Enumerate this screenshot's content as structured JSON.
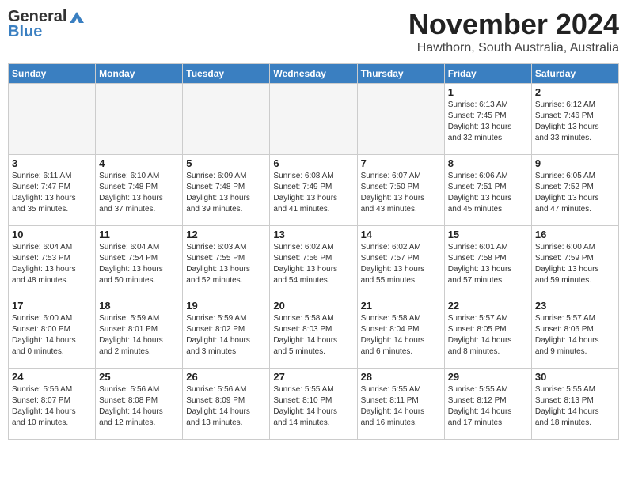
{
  "header": {
    "logo_general": "General",
    "logo_blue": "Blue",
    "month_title": "November 2024",
    "location": "Hawthorn, South Australia, Australia"
  },
  "days_of_week": [
    "Sunday",
    "Monday",
    "Tuesday",
    "Wednesday",
    "Thursday",
    "Friday",
    "Saturday"
  ],
  "weeks": [
    [
      {
        "num": "",
        "info": ""
      },
      {
        "num": "",
        "info": ""
      },
      {
        "num": "",
        "info": ""
      },
      {
        "num": "",
        "info": ""
      },
      {
        "num": "",
        "info": ""
      },
      {
        "num": "1",
        "info": "Sunrise: 6:13 AM\nSunset: 7:45 PM\nDaylight: 13 hours\nand 32 minutes."
      },
      {
        "num": "2",
        "info": "Sunrise: 6:12 AM\nSunset: 7:46 PM\nDaylight: 13 hours\nand 33 minutes."
      }
    ],
    [
      {
        "num": "3",
        "info": "Sunrise: 6:11 AM\nSunset: 7:47 PM\nDaylight: 13 hours\nand 35 minutes."
      },
      {
        "num": "4",
        "info": "Sunrise: 6:10 AM\nSunset: 7:48 PM\nDaylight: 13 hours\nand 37 minutes."
      },
      {
        "num": "5",
        "info": "Sunrise: 6:09 AM\nSunset: 7:48 PM\nDaylight: 13 hours\nand 39 minutes."
      },
      {
        "num": "6",
        "info": "Sunrise: 6:08 AM\nSunset: 7:49 PM\nDaylight: 13 hours\nand 41 minutes."
      },
      {
        "num": "7",
        "info": "Sunrise: 6:07 AM\nSunset: 7:50 PM\nDaylight: 13 hours\nand 43 minutes."
      },
      {
        "num": "8",
        "info": "Sunrise: 6:06 AM\nSunset: 7:51 PM\nDaylight: 13 hours\nand 45 minutes."
      },
      {
        "num": "9",
        "info": "Sunrise: 6:05 AM\nSunset: 7:52 PM\nDaylight: 13 hours\nand 47 minutes."
      }
    ],
    [
      {
        "num": "10",
        "info": "Sunrise: 6:04 AM\nSunset: 7:53 PM\nDaylight: 13 hours\nand 48 minutes."
      },
      {
        "num": "11",
        "info": "Sunrise: 6:04 AM\nSunset: 7:54 PM\nDaylight: 13 hours\nand 50 minutes."
      },
      {
        "num": "12",
        "info": "Sunrise: 6:03 AM\nSunset: 7:55 PM\nDaylight: 13 hours\nand 52 minutes."
      },
      {
        "num": "13",
        "info": "Sunrise: 6:02 AM\nSunset: 7:56 PM\nDaylight: 13 hours\nand 54 minutes."
      },
      {
        "num": "14",
        "info": "Sunrise: 6:02 AM\nSunset: 7:57 PM\nDaylight: 13 hours\nand 55 minutes."
      },
      {
        "num": "15",
        "info": "Sunrise: 6:01 AM\nSunset: 7:58 PM\nDaylight: 13 hours\nand 57 minutes."
      },
      {
        "num": "16",
        "info": "Sunrise: 6:00 AM\nSunset: 7:59 PM\nDaylight: 13 hours\nand 59 minutes."
      }
    ],
    [
      {
        "num": "17",
        "info": "Sunrise: 6:00 AM\nSunset: 8:00 PM\nDaylight: 14 hours\nand 0 minutes."
      },
      {
        "num": "18",
        "info": "Sunrise: 5:59 AM\nSunset: 8:01 PM\nDaylight: 14 hours\nand 2 minutes."
      },
      {
        "num": "19",
        "info": "Sunrise: 5:59 AM\nSunset: 8:02 PM\nDaylight: 14 hours\nand 3 minutes."
      },
      {
        "num": "20",
        "info": "Sunrise: 5:58 AM\nSunset: 8:03 PM\nDaylight: 14 hours\nand 5 minutes."
      },
      {
        "num": "21",
        "info": "Sunrise: 5:58 AM\nSunset: 8:04 PM\nDaylight: 14 hours\nand 6 minutes."
      },
      {
        "num": "22",
        "info": "Sunrise: 5:57 AM\nSunset: 8:05 PM\nDaylight: 14 hours\nand 8 minutes."
      },
      {
        "num": "23",
        "info": "Sunrise: 5:57 AM\nSunset: 8:06 PM\nDaylight: 14 hours\nand 9 minutes."
      }
    ],
    [
      {
        "num": "24",
        "info": "Sunrise: 5:56 AM\nSunset: 8:07 PM\nDaylight: 14 hours\nand 10 minutes."
      },
      {
        "num": "25",
        "info": "Sunrise: 5:56 AM\nSunset: 8:08 PM\nDaylight: 14 hours\nand 12 minutes."
      },
      {
        "num": "26",
        "info": "Sunrise: 5:56 AM\nSunset: 8:09 PM\nDaylight: 14 hours\nand 13 minutes."
      },
      {
        "num": "27",
        "info": "Sunrise: 5:55 AM\nSunset: 8:10 PM\nDaylight: 14 hours\nand 14 minutes."
      },
      {
        "num": "28",
        "info": "Sunrise: 5:55 AM\nSunset: 8:11 PM\nDaylight: 14 hours\nand 16 minutes."
      },
      {
        "num": "29",
        "info": "Sunrise: 5:55 AM\nSunset: 8:12 PM\nDaylight: 14 hours\nand 17 minutes."
      },
      {
        "num": "30",
        "info": "Sunrise: 5:55 AM\nSunset: 8:13 PM\nDaylight: 14 hours\nand 18 minutes."
      }
    ]
  ]
}
